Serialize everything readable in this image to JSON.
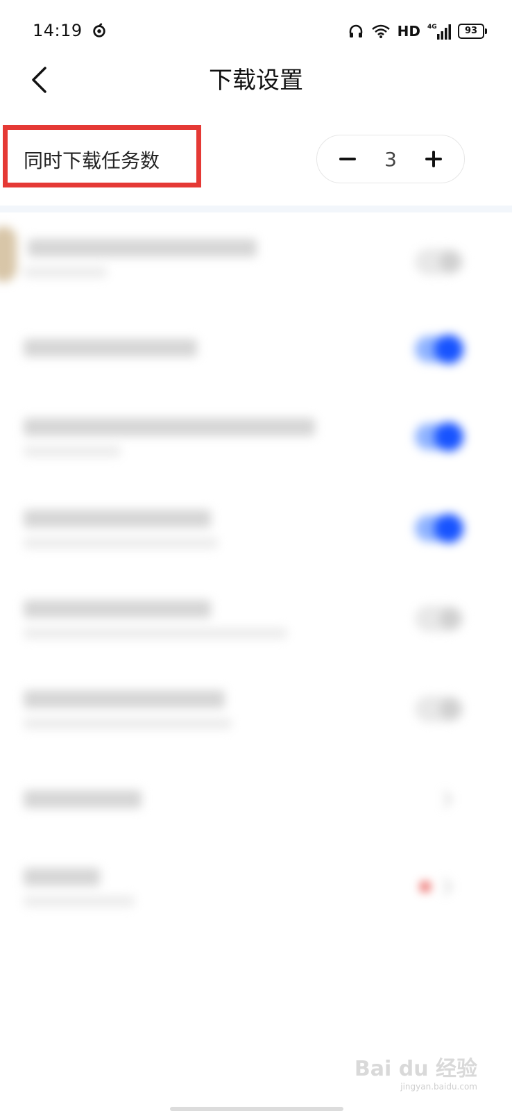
{
  "status_bar": {
    "time": "14:19",
    "network_label": "HD",
    "cellular_label": "4G",
    "battery_level": "93",
    "icons": [
      "netease-music-icon",
      "headset-icon",
      "wifi-icon",
      "cellular-signal-icon",
      "battery-icon"
    ]
  },
  "header": {
    "title": "下载设置",
    "back_icon": "chevron-left-icon"
  },
  "concurrent_tasks": {
    "label": "同时下载任务数",
    "value": "3",
    "decrement": "−",
    "increment": "+",
    "highlight_color": "#e53935"
  },
  "blurred_settings": {
    "toggle_on_color": "#1753ff",
    "toggle_off_color": "#e8e8e8",
    "item_states": [
      "off",
      "on",
      "on",
      "on",
      "off",
      "off",
      "chevron",
      "badge-chevron"
    ]
  },
  "watermark": {
    "brand": "Bai du 经验",
    "site": "jingyan.baidu.com"
  }
}
